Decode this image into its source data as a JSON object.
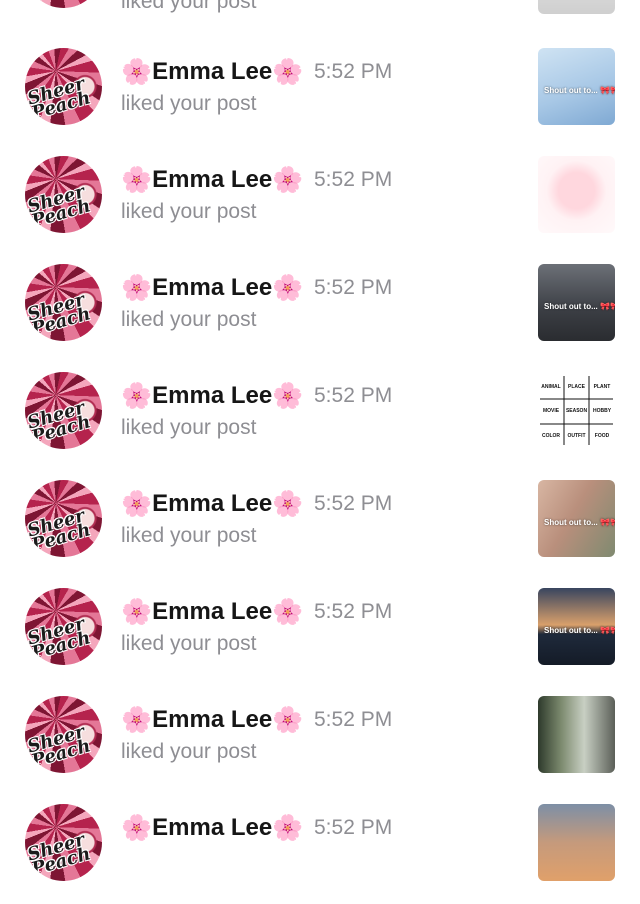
{
  "partial_row": {
    "action": "liked your post"
  },
  "rows": [
    {
      "name": "Emma Lee",
      "time": "5:52 PM",
      "action": "liked your post",
      "thumb_caption": "Shout out to... 🎀🎀"
    },
    {
      "name": "Emma Lee",
      "time": "5:52 PM",
      "action": "liked your post",
      "thumb_caption": ""
    },
    {
      "name": "Emma Lee",
      "time": "5:52 PM",
      "action": "liked your post",
      "thumb_caption": "Shout out to... 🎀🎀"
    },
    {
      "name": "Emma Lee",
      "time": "5:52 PM",
      "action": "liked your post",
      "thumb_caption": ""
    },
    {
      "name": "Emma Lee",
      "time": "5:52 PM",
      "action": "liked your post",
      "thumb_caption": "Shout out to... 🎀🎀"
    },
    {
      "name": "Emma Lee",
      "time": "5:52 PM",
      "action": "liked your post",
      "thumb_caption": "Shout out to... 🎀🎀"
    },
    {
      "name": "Emma Lee",
      "time": "5:52 PM",
      "action": "liked your post",
      "thumb_caption": ""
    },
    {
      "name": "Emma Lee",
      "time": "5:52 PM",
      "action": "",
      "thumb_caption": ""
    }
  ],
  "flower_emoji": "🌸",
  "avatar_text": "Sheer Peach",
  "grid_thumb_words": [
    "ANIMAL",
    "PLACE",
    "PLANT",
    "MOVIE",
    "SEASON",
    "HOBBY",
    "COLOR",
    "OUTFIT",
    "FOOD"
  ],
  "colors": {
    "name": "#161616",
    "secondary": "#8e8e93",
    "avatar_accent": "#b5234d"
  }
}
